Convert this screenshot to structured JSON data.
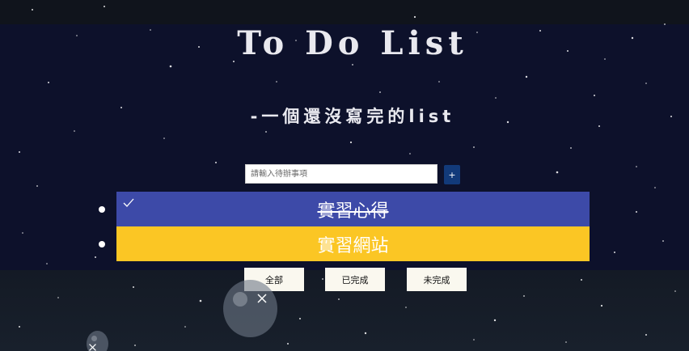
{
  "header": {
    "title": "To Do List",
    "subtitle": "-一個還沒寫完的list"
  },
  "input": {
    "placeholder": "請輸入待辦事項",
    "add_label": "+"
  },
  "todos": [
    {
      "text": "實習心得",
      "completed": true,
      "color": "#3d4aa8"
    },
    {
      "text": "實習網站",
      "completed": false,
      "color": "#fbc624"
    }
  ],
  "filters": [
    {
      "label": "全部"
    },
    {
      "label": "已完成"
    },
    {
      "label": "未完成"
    }
  ],
  "colors": {
    "background": "#0d112b",
    "add_button": "#123a7a",
    "filter_button": "#faf8ef"
  },
  "icons": {
    "check": "check-icon",
    "close": "close-icon"
  }
}
